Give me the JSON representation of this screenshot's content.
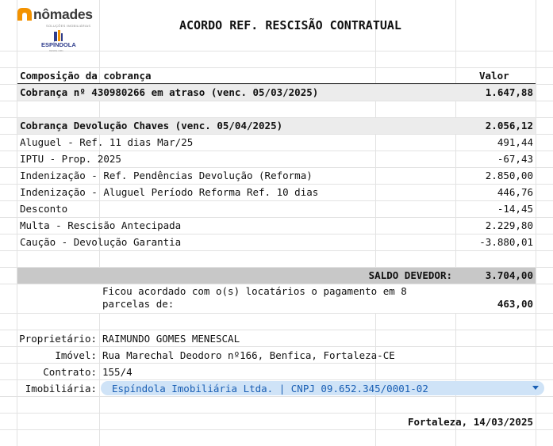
{
  "colors": {
    "orange": "#f39200",
    "navy": "#2f3d8c",
    "band_light": "#ececec",
    "band_dark": "#c8c8c8",
    "dropdown_bg": "#cfe3f7",
    "dropdown_text": "#1a5fb4"
  },
  "logo": {
    "brand": "nômades",
    "brand_sub": "SOLUÇÕES IMOBILIÁRIAS",
    "partner": "ESPÍNDOLA",
    "partner_sub": "DESDE 1961",
    "brand_icon": "nomades-n-icon",
    "partner_icon": "espindola-building-icon"
  },
  "title": "ACORDO REF. RESCISÃO CONTRATUAL",
  "table": {
    "header": {
      "label": "Composição da cobrança",
      "value": "Valor"
    },
    "overdue": {
      "label": "Cobrança nº 430980266 em atraso (venc. 05/03/2025)",
      "value": "1.647,88"
    },
    "group": {
      "label": "Cobrança Devolução Chaves (venc. 05/04/2025)",
      "value": "2.056,12"
    },
    "items": [
      {
        "label": "Aluguel - Ref. 11 dias Mar/25",
        "value": "491,44"
      },
      {
        "label": "IPTU - Prop. 2025",
        "value": "-67,43"
      },
      {
        "label": "Indenização - Ref. Pendências Devolução (Reforma)",
        "value": "2.850,00"
      },
      {
        "label": "Indenização - Aluguel Período Reforma Ref. 10 dias",
        "value": "446,76"
      },
      {
        "label": "Desconto",
        "value": "-14,45"
      },
      {
        "label": "Multa - Rescisão Antecipada",
        "value": "2.229,80"
      },
      {
        "label": "Caução - Devolução Garantia",
        "value": "-3.880,01"
      }
    ],
    "balance": {
      "label": "SALDO DEVEDOR:",
      "value": "3.704,00"
    },
    "agreement": {
      "line1": "Ficou acordado com o(s) locatários o pagamento em 8",
      "line2": "parcelas de:",
      "value": "463,00"
    }
  },
  "info": {
    "owner": {
      "label": "Proprietário:",
      "value": "RAIMUNDO GOMES MENESCAL"
    },
    "property": {
      "label": "Imóvel:",
      "value": "Rua Marechal Deodoro nº166, Benfica, Fortaleza-CE"
    },
    "contract": {
      "label": "Contrato:",
      "value": "155/4"
    },
    "agency": {
      "label": "Imobiliária:",
      "value": "Espíndola Imobiliária Ltda. | CNPJ 09.652.345/0001-02"
    }
  },
  "footer": {
    "place_date": "Fortaleza, 14/03/2025"
  }
}
